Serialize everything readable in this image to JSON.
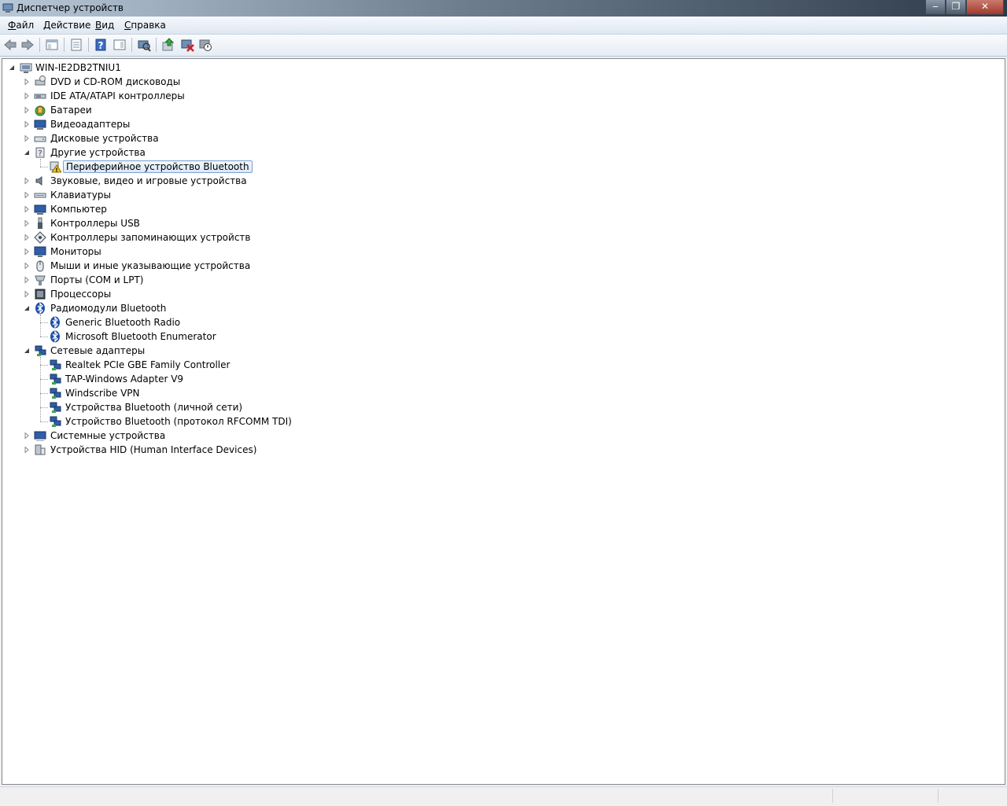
{
  "window": {
    "title": "Диспетчер устройств",
    "controls": {
      "minimize": "‒",
      "maximize": "❐",
      "close": "✕"
    }
  },
  "menu": [
    {
      "label": "Файл",
      "accel": "Ф",
      "rest": "айл"
    },
    {
      "label": "Действие",
      "accel": "Д",
      "rest": "ействие"
    },
    {
      "label": "Вид",
      "accel": "В",
      "rest": "ид"
    },
    {
      "label": "Справка",
      "accel": "С",
      "rest": "правка"
    }
  ],
  "toolbar": {
    "buttons": [
      "back-arrow-icon",
      "forward-arrow-icon",
      "show-hide-tree-icon",
      "properties-icon",
      "help-icon",
      "action-pane-icon",
      "scan-hardware-icon",
      "update-driver-icon",
      "uninstall-icon",
      "disable-device-icon"
    ]
  },
  "tree": {
    "root": "WIN-IE2DB2TNIU1",
    "categories": [
      {
        "label": "DVD и CD-ROM дисководы",
        "icon": "dvd-drive-icon",
        "expanded": false
      },
      {
        "label": "IDE ATA/ATAPI контроллеры",
        "icon": "ide-controller-icon",
        "expanded": false
      },
      {
        "label": "Батареи",
        "icon": "battery-icon",
        "expanded": false
      },
      {
        "label": "Видеоадаптеры",
        "icon": "display-adapter-icon",
        "expanded": false
      },
      {
        "label": "Дисковые устройства",
        "icon": "disk-drive-icon",
        "expanded": false
      },
      {
        "label": "Другие устройства",
        "icon": "other-devices-icon",
        "expanded": true,
        "children": [
          {
            "label": "Периферийное устройство Bluetooth",
            "icon": "warning-device-icon",
            "selected": true
          }
        ]
      },
      {
        "label": "Звуковые, видео и игровые устройства",
        "icon": "speaker-icon",
        "expanded": false
      },
      {
        "label": "Клавиатуры",
        "icon": "keyboard-icon",
        "expanded": false
      },
      {
        "label": "Компьютер",
        "icon": "computer-icon",
        "expanded": false
      },
      {
        "label": "Контроллеры USB",
        "icon": "usb-icon",
        "expanded": false
      },
      {
        "label": "Контроллеры запоминающих устройств",
        "icon": "storage-controller-icon",
        "expanded": false
      },
      {
        "label": "Мониторы",
        "icon": "monitor-icon",
        "expanded": false
      },
      {
        "label": "Мыши и иные указывающие устройства",
        "icon": "mouse-icon",
        "expanded": false
      },
      {
        "label": "Порты (COM и LPT)",
        "icon": "port-icon",
        "expanded": false
      },
      {
        "label": "Процессоры",
        "icon": "processor-icon",
        "expanded": false
      },
      {
        "label": "Радиомодули Bluetooth",
        "icon": "bluetooth-icon",
        "expanded": true,
        "children": [
          {
            "label": "Generic Bluetooth Radio",
            "icon": "bluetooth-icon"
          },
          {
            "label": "Microsoft Bluetooth Enumerator",
            "icon": "bluetooth-icon"
          }
        ]
      },
      {
        "label": "Сетевые адаптеры",
        "icon": "network-adapter-icon",
        "expanded": true,
        "children": [
          {
            "label": "Realtek PCIe GBE Family Controller",
            "icon": "network-adapter-icon"
          },
          {
            "label": "TAP-Windows Adapter V9",
            "icon": "network-adapter-icon"
          },
          {
            "label": "Windscribe VPN",
            "icon": "network-adapter-icon"
          },
          {
            "label": "Устройства Bluetooth (личной сети)",
            "icon": "network-adapter-icon"
          },
          {
            "label": "Устройство Bluetooth (протокол RFCOMM TDI)",
            "icon": "network-adapter-icon"
          }
        ]
      },
      {
        "label": "Системные устройства",
        "icon": "system-devices-icon",
        "expanded": false
      },
      {
        "label": "Устройства HID (Human Interface Devices)",
        "icon": "hid-icon",
        "expanded": false
      }
    ]
  }
}
